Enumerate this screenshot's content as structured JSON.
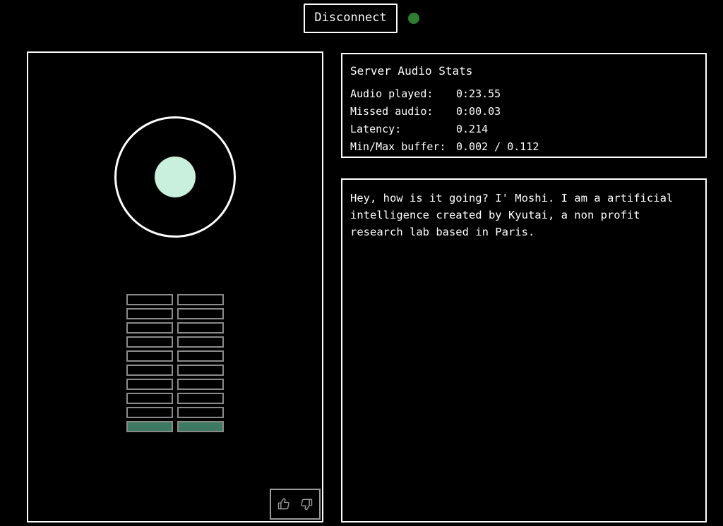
{
  "topbar": {
    "disconnect_label": "Disconnect",
    "status_dot_color": "#2e7d32",
    "status_dot_name": "connection-status-dot"
  },
  "stats": {
    "title": "Server Audio Stats",
    "rows": [
      {
        "label": "Audio played:",
        "value": "0:23.55"
      },
      {
        "label": "Missed audio:",
        "value": "0:00.03"
      },
      {
        "label": "Latency:",
        "value": "0.214"
      },
      {
        "label": "Min/Max buffer:",
        "value": "0.002 / 0.112"
      }
    ]
  },
  "transcript": {
    "text": "Hey, how is it going? I' Moshi. I am a artificial intelligence created by Kyutai, a non profit research lab based in Paris."
  },
  "visualizer": {
    "ring_color": "#ffffff",
    "inner_dot_color": "#c9f0dc",
    "meter": {
      "rows": 10,
      "columns": 2,
      "active_rows": 1,
      "active_color": "#3d7a61",
      "inactive_border_color": "#8a8a8a"
    }
  },
  "feedback": {
    "thumbs_up_icon": "thumbs-up-icon",
    "thumbs_down_icon": "thumbs-down-icon"
  }
}
